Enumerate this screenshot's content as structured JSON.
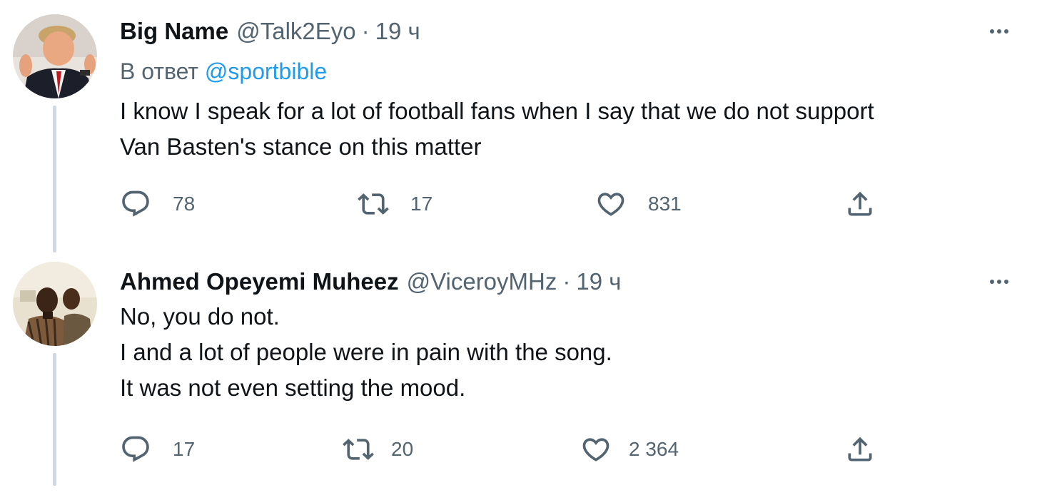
{
  "tweets": [
    {
      "name": "Big Name",
      "handle": "@Talk2Eyo",
      "separator": "·",
      "time": "19 ч",
      "reply_prefix": "В ответ",
      "reply_mention": "@sportbible",
      "text_lines": [
        "I know I speak for a lot of football fans when I say that we do not support",
        "Van Basten's stance on this matter"
      ],
      "replies": "78",
      "retweets": "17",
      "likes": "831"
    },
    {
      "name": "Ahmed Opeyemi Muheez",
      "handle": "@ViceroyMHz",
      "separator": "·",
      "time": "19 ч",
      "text_lines": [
        "No, you do not.",
        "I and a lot of people were in pain with the song.",
        "It was not even setting the mood."
      ],
      "replies": "17",
      "retweets": "20",
      "likes": "2 364"
    }
  ],
  "icons": {
    "reply": "reply-icon",
    "retweet": "retweet-icon",
    "like": "heart-icon",
    "share": "share-icon",
    "more": "more-horizontal-icon"
  },
  "colors": {
    "text": "#0f1419",
    "secondary": "#536471",
    "link": "#1d9bf0",
    "thread_line": "#cfd9de"
  }
}
